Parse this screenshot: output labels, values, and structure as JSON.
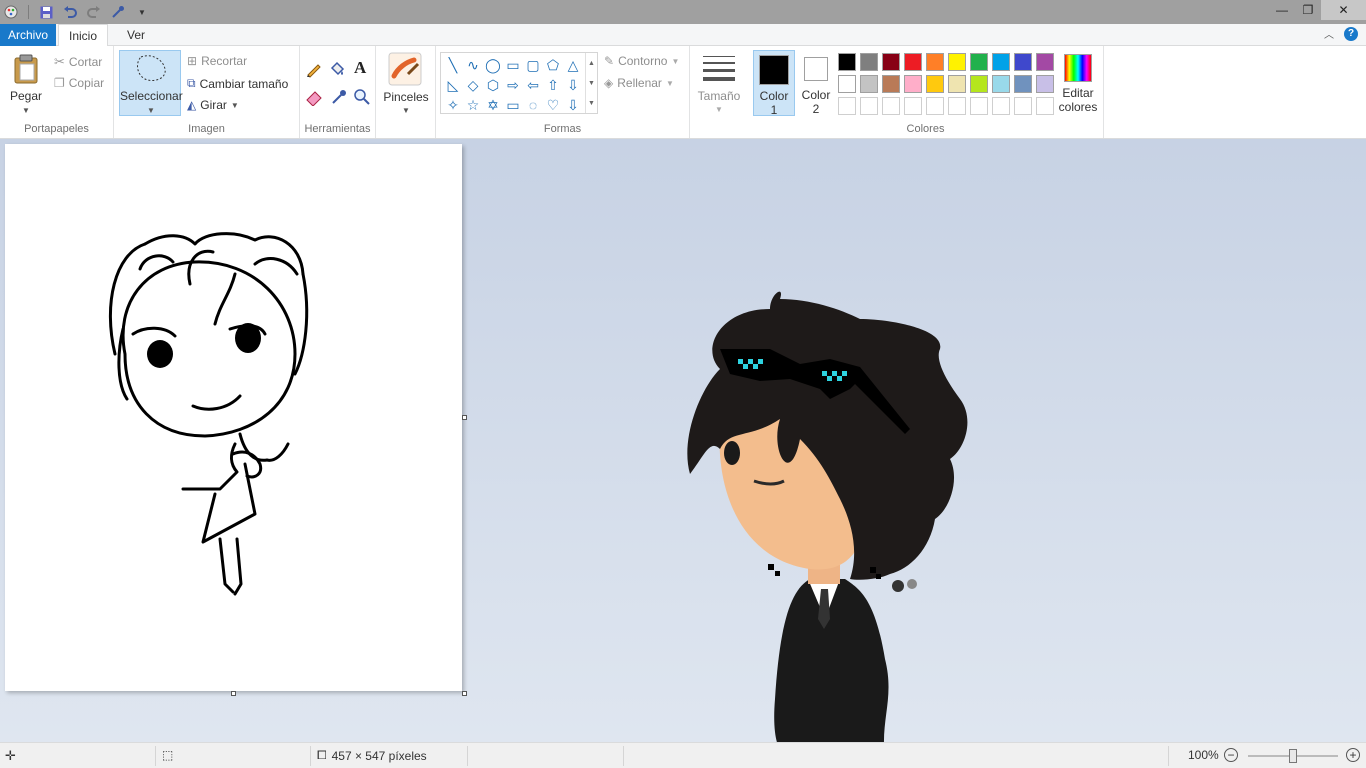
{
  "tabs": {
    "file": "Archivo",
    "home": "Inicio",
    "view": "Ver"
  },
  "clipboard": {
    "paste": "Pegar",
    "cut": "Cortar",
    "copy": "Copiar",
    "label": "Portapapeles"
  },
  "image": {
    "select": "Seleccionar",
    "crop": "Recortar",
    "resize": "Cambiar tamaño",
    "rotate": "Girar",
    "label": "Imagen"
  },
  "tools": {
    "label": "Herramientas",
    "text_tool": "A"
  },
  "brushes": {
    "label": "Pinceles"
  },
  "shapes": {
    "label": "Formas",
    "outline": "Contorno",
    "fill": "Rellenar",
    "icons": [
      "╲",
      "∿",
      "◯",
      "▭",
      "▢",
      "⬠",
      "△",
      "◺",
      "◇",
      "⬡",
      "⇨",
      "⇦",
      "⇧",
      "⇩",
      "✧",
      "☆",
      "✡",
      "▭",
      "◌",
      "♡",
      "⇩"
    ]
  },
  "size": {
    "label": "Tamaño"
  },
  "colors": {
    "label": "Colores",
    "color1": "Color 1",
    "color1_a": "Color",
    "color1_b": "1",
    "color2_a": "Color",
    "color2_b": "2",
    "color1_value": "#000000",
    "color2_value": "#ffffff",
    "edit_a": "Editar",
    "edit_b": "colores",
    "palette": [
      "#000000",
      "#7f7f7f",
      "#880015",
      "#ed1c24",
      "#ff7f27",
      "#fff200",
      "#22b14c",
      "#00a2e8",
      "#3f48cc",
      "#a349a4",
      "#ffffff",
      "#c3c3c3",
      "#b97a57",
      "#ffaec9",
      "#ffc90e",
      "#efe4b0",
      "#b5e61d",
      "#99d9ea",
      "#7092be",
      "#c8bfe7",
      "#ffffff",
      "#ffffff",
      "#ffffff",
      "#ffffff",
      "#ffffff",
      "#ffffff",
      "#ffffff",
      "#ffffff",
      "#ffffff",
      "#ffffff"
    ]
  },
  "status": {
    "dimensions": "457 × 547 píxeles",
    "zoom": "100%",
    "zoom_level": 0.5
  }
}
